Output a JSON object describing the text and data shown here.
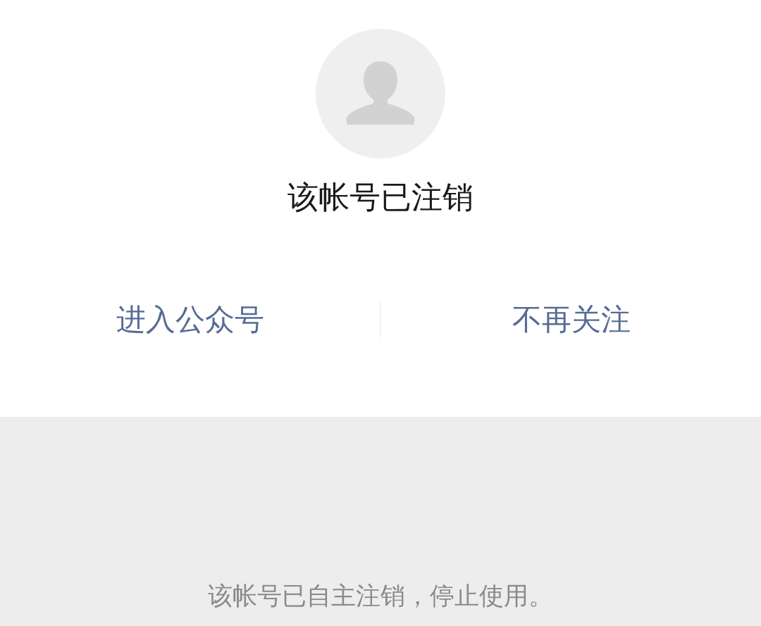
{
  "profile": {
    "title": "该帐号已注销"
  },
  "actions": [
    {
      "label": "进入公众号"
    },
    {
      "label": "不再关注"
    }
  ],
  "notice": "该帐号已自主注销，停止使用。"
}
